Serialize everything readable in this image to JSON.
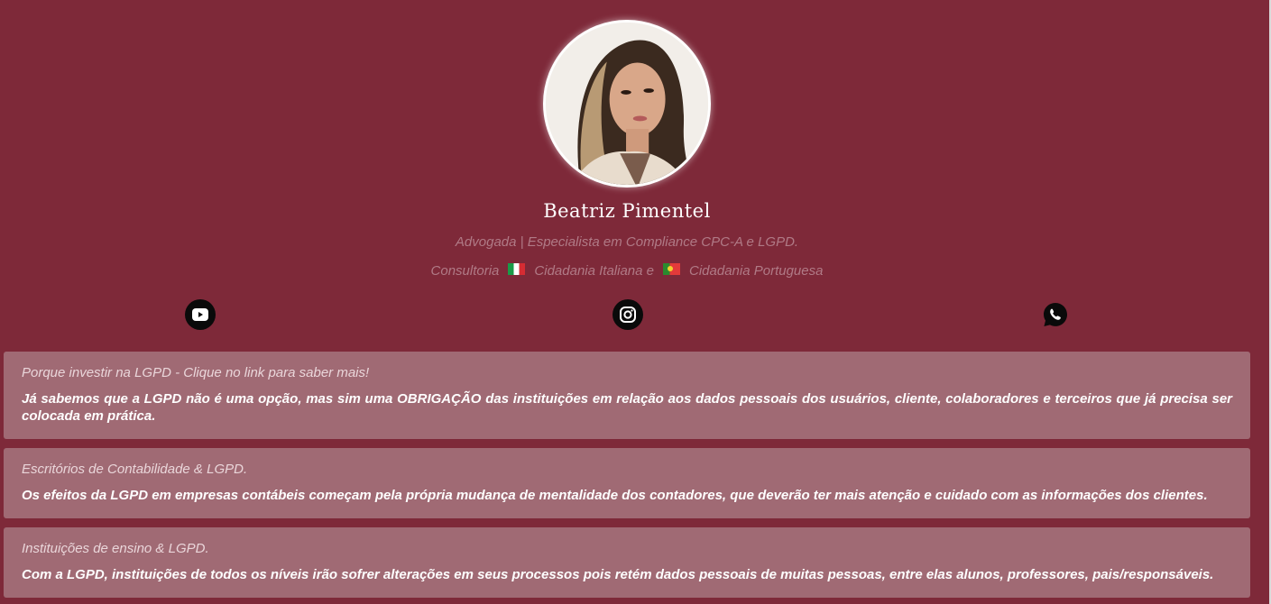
{
  "profile": {
    "name": "Beatriz Pimentel",
    "subtitle": "Advogada | Especialista em Compliance CPC-A e LGPD.",
    "services": {
      "prefix": "Consultoria",
      "italian": "Cidadania Italiana e",
      "portuguese": "Cidadania Portuguesa"
    }
  },
  "social": [
    {
      "name": "youtube-icon"
    },
    {
      "name": "instagram-icon"
    },
    {
      "name": "whatsapp-icon"
    }
  ],
  "cards": [
    {
      "title": "Porque investir na LGPD - Clique no link para saber mais!",
      "description": "Já sabemos que a LGPD não é uma opção, mas sim uma OBRIGAÇÃO das instituições em relação aos dados pessoais dos usuários, cliente, colaboradores e terceiros que já precisa ser colocada em prática."
    },
    {
      "title": "Escritórios de Contabilidade & LGPD.",
      "description": "Os efeitos da LGPD em empresas contábeis começam pela própria mudança de mentalidade dos contadores, que deverão ter mais atenção e cuidado com as informações dos clientes."
    },
    {
      "title": "Instituições de ensino & LGPD.",
      "description": "Com a LGPD, instituições de todos os níveis irão sofrer alterações em seus processos pois retém dados pessoais de muitas pessoas, entre elas alunos, professores, pais/responsáveis."
    }
  ],
  "colors": {
    "background": "#7e2939",
    "card": "#a06a74",
    "muted_text": "#b07a86"
  }
}
